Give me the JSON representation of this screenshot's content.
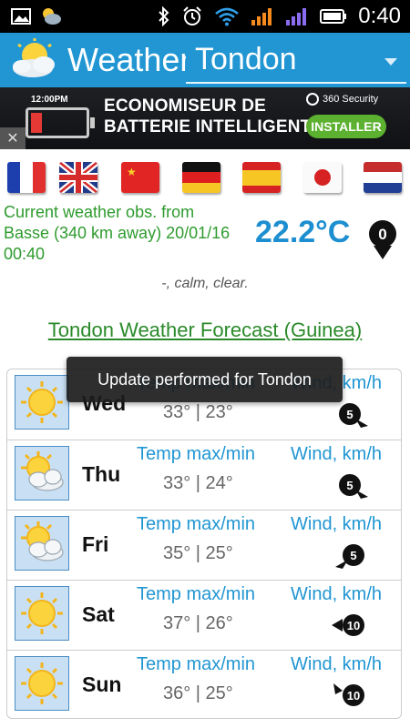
{
  "status_bar": {
    "time": "0:40",
    "icons": [
      "gallery-icon",
      "app-thumbnail-icon",
      "bluetooth-icon",
      "alarm-icon",
      "wifi-icon",
      "signal-orange-icon",
      "signal-purple-icon",
      "battery-icon"
    ]
  },
  "app_bar": {
    "title": "Weather",
    "city": "Tondon",
    "logo": "sun-cloud-logo"
  },
  "ad": {
    "clock": "12:00PM",
    "line1": "ECONOMISEUR DE",
    "line2": "BATTERIE INTELLIGENT",
    "brand": "360 Security",
    "install": "INSTALLER",
    "close": "✕"
  },
  "flags": [
    "france-flag-icon",
    "uk-flag-icon",
    "china-flag-icon",
    "germany-flag-icon",
    "spain-flag-icon",
    "japan-flag-icon",
    "netherlands-flag-icon"
  ],
  "current": {
    "line1": "Current weather  obs.  from",
    "line2": "Basse (340 km away)  20/01/16",
    "line3": "00:40",
    "temperature": "22.2°C",
    "wind_speed": "0",
    "condition": "-, calm, clear."
  },
  "forecast": {
    "title": "Tondon Weather Forecast (Guinea)",
    "temp_label": "Temp max/min",
    "wind_label": "Wind, km/h",
    "days": [
      {
        "day": "Wed",
        "temps": "33° | 23°",
        "wind": "5",
        "icon": "sunny-icon",
        "wind_dir": "down-right"
      },
      {
        "day": "Thu",
        "temps": "33° | 24°",
        "wind": "5",
        "icon": "partly-cloudy-icon",
        "wind_dir": "down-right"
      },
      {
        "day": "Fri",
        "temps": "35° | 25°",
        "wind": "5",
        "icon": "partly-cloudy-icon",
        "wind_dir": "down-left"
      },
      {
        "day": "Sat",
        "temps": "37° | 26°",
        "wind": "10",
        "icon": "sunny-icon",
        "wind_dir": "left"
      },
      {
        "day": "Sun",
        "temps": "36° | 25°",
        "wind": "10",
        "icon": "sunny-icon",
        "wind_dir": "up-left"
      }
    ]
  },
  "toast": "Update performed for Tondon",
  "colors": {
    "app_bar": "#2196d3",
    "obs_text": "#2e9b2e",
    "temperature": "#1d8fd0",
    "forecast_title": "#2a8a2a",
    "label_blue": "#2196d3"
  }
}
